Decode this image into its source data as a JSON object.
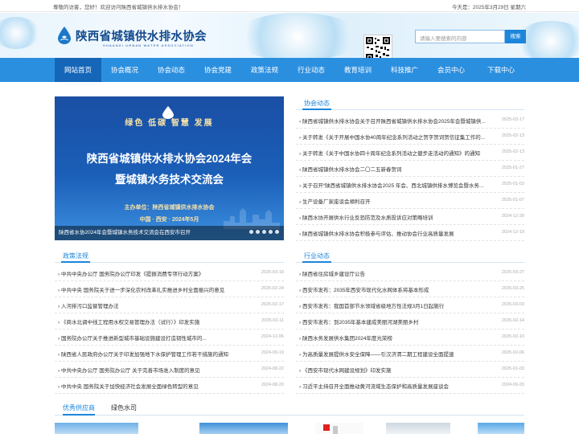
{
  "topbar": {
    "welcome": "尊敬的访客，您好！欢迎访问陕西省城镇供水排水协会！",
    "date": "今天是：2025年3月29日 星期六"
  },
  "header": {
    "name_cn": "陕西省城镇供水排水协会",
    "name_en": "SHAANXI URBAN WATER ASSOCIATION"
  },
  "search": {
    "placeholder": "请输入要搜索的内容",
    "button": "搜索"
  },
  "nav": [
    "网站首页",
    "协会概况",
    "协会动态",
    "协会党建",
    "政策法规",
    "行业动态",
    "教育培训",
    "科技推广",
    "会员中心",
    "下载中心"
  ],
  "banner": {
    "slogan": "绿色  低碳  智慧  发展",
    "title1": "陕西省城镇供水排水协会2024年会",
    "title2": "暨城镇水务技术交流会",
    "host": "主办单位：陕西省城镇供水排水协会",
    "place": "中国 · 西安 · 2024年5月",
    "caption": "陕西省水协2024年会暨城镇水务技术交流会在西安市召开"
  },
  "association_news": {
    "title": "协会动态",
    "items": [
      {
        "t": "陕西省城镇供水排水协会关于召开陕西省城镇供水排水协会2025年会暨城镇供...",
        "d": "2025-03-17"
      },
      {
        "t": "关于转发《关于开展中国水协40周年纪念系列活动之贺字贺词贺信征集工作的...",
        "d": "2025-02-13"
      },
      {
        "t": "关于转发《关于中国水协四十周年纪念系列活动之健步走活动的通知》的通知",
        "d": "2025-02-13"
      },
      {
        "t": "陕西省城镇供水排水协会二〇二五新春贺词",
        "d": "2025-01-27"
      },
      {
        "t": "关于召开“陕西省城镇供水排水协会2025 年会、西北城镇供排水博览会暨水务...",
        "d": "2025-01-03"
      },
      {
        "t": "生产设备厂家座谈会顺利召开",
        "d": "2025-01-07"
      },
      {
        "t": "陕西水协开展供水行业反恐防范及水质投诉应对策略培训",
        "d": "2024-12-30"
      },
      {
        "t": "陕西省城镇供水排水协会积极参与评估、推动协会行业高质量发展",
        "d": "2024-12-19"
      }
    ]
  },
  "policy": {
    "title": "政策法规",
    "items": [
      {
        "t": "中共中央办公厅 国务院办公厅印发《提振消费专项行动方案》",
        "d": "2025-03-18"
      },
      {
        "t": "中共中央 国务院关于进一步深化农村改革扎实推进乡村全面振兴的意见",
        "d": "2025-02-24"
      },
      {
        "t": "入河排污口监督管理办法",
        "d": "2025-02-17"
      },
      {
        "t": "《商水北调中线工程用水权交易管理办法（试行）》印发实施",
        "d": "2025-02-11"
      },
      {
        "t": "国务院办公厅关于推进新型城市基础设施建设打造韧性城市的...",
        "d": "2024-12-06"
      },
      {
        "t": "陕西省人民政府办公厅关于印发加强地下水保护管理工作若干措施的通知",
        "d": "2024-09-19"
      },
      {
        "t": "中共中央办公厅 国务院办公厅 关于完善市场准入制度的意见",
        "d": "2024-08-22"
      },
      {
        "t": "中共中央 国务院关于加快经济社会发展全面绿色转型的意见",
        "d": "2024-08-20"
      }
    ]
  },
  "industry": {
    "title": "行业动态",
    "items": [
      {
        "t": "陕西省住房城乡建设厅公告",
        "d": "2025-03-27"
      },
      {
        "t": "西安市发布：2035年西安市现代化水网体系将基本形成",
        "d": "2025-03-25"
      },
      {
        "t": "西安市发布：我国首部节水领域省级地方性法规3月1日起施行",
        "d": "2025-03-03"
      },
      {
        "t": "西安市发布：到2035年基本建成美丽河湖美丽乡村",
        "d": "2025-02-14"
      },
      {
        "t": "陕西水务发展供水集团2024年度光荣榜",
        "d": "2025-02-10"
      },
      {
        "t": "为高质量发展提供水安全保障——引汉济渭二期工程建设全面提速",
        "d": "2025-02-06"
      },
      {
        "t": "《西安市现代水网建设规划》印发实施",
        "d": "2025-01-03"
      },
      {
        "t": "习近平主持召开全面推动黄河流域生态保护和高质量发展座谈会",
        "d": "2024-09-20"
      }
    ]
  },
  "bottom_tabs": [
    "优秀供应商",
    "绿色水司"
  ]
}
